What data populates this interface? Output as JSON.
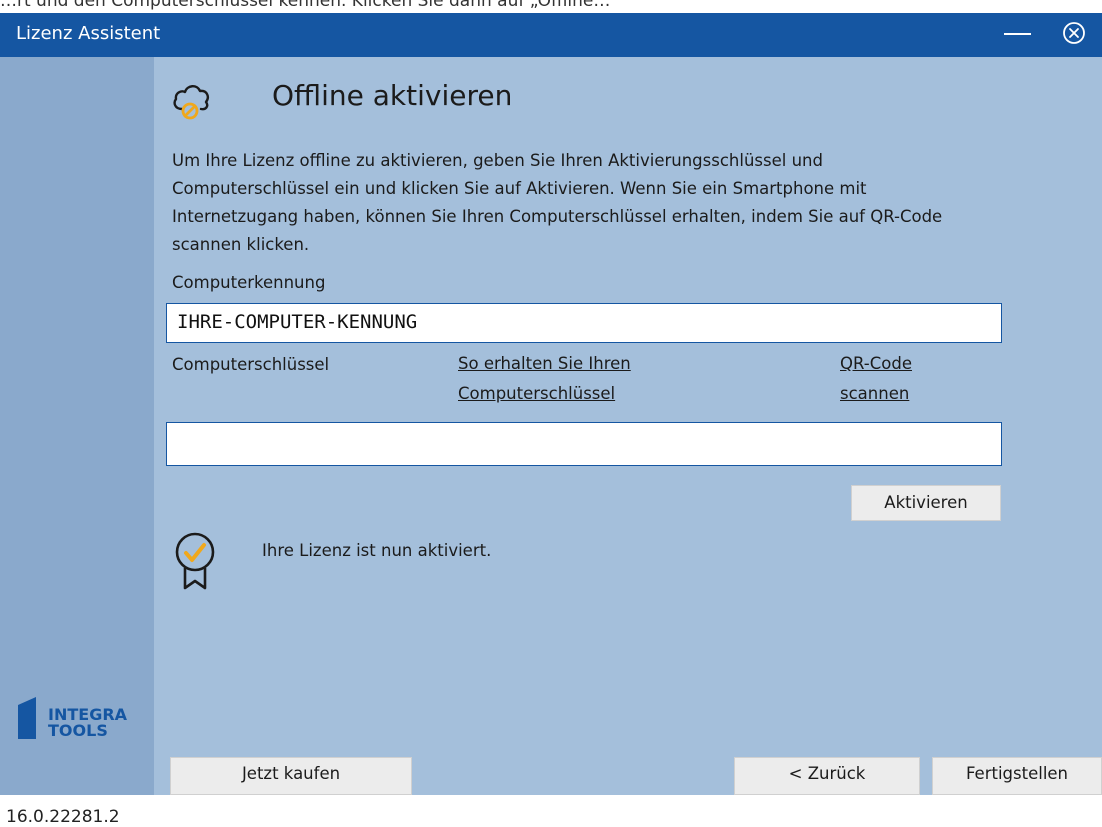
{
  "top_strip": {
    "text": "…rt und den Computerschlüssel kennen. Klicken Sie dann auf „Offline…"
  },
  "window": {
    "title": "Lizenz Assistent"
  },
  "sidebar": {
    "logo_line1": "INTEGRA",
    "logo_line2": "TOOLS",
    "version": "16.0.22281.2"
  },
  "page": {
    "title": "Offline aktivieren",
    "description": "Um Ihre Lizenz offline zu aktivieren, geben Sie Ihren Aktivierungsschlüssel und Computerschlüssel ein und klicken Sie auf Aktivieren. Wenn Sie ein Smartphone mit Internetzugang haben, können Sie Ihren Computerschlüssel erhalten, indem Sie auf QR-Code scannen klicken.",
    "computer_id_label": "Computerkennung",
    "computer_id_value": "IHRE-COMPUTER-KENNUNG",
    "computer_key_label": "Computerschlüssel",
    "howto_link_line1": "So erhalten Sie Ihren",
    "howto_link_line2": "Computerschlüssel",
    "qr_link_line1": "QR-Code",
    "qr_link_line2": "scannen",
    "computer_key_value": "",
    "activate_label": "Aktivieren",
    "status_message": "Ihre Lizenz ist nun aktiviert."
  },
  "footer": {
    "buy_label": "Jetzt kaufen",
    "back_label": "< Zurück",
    "finish_label": "Fertigstellen"
  },
  "colors": {
    "titlebar": "#1556a2",
    "content_bg": "#a4bfdb",
    "sidebar_bg": "#8aa9cc",
    "accent_orange": "#f0a81c"
  }
}
